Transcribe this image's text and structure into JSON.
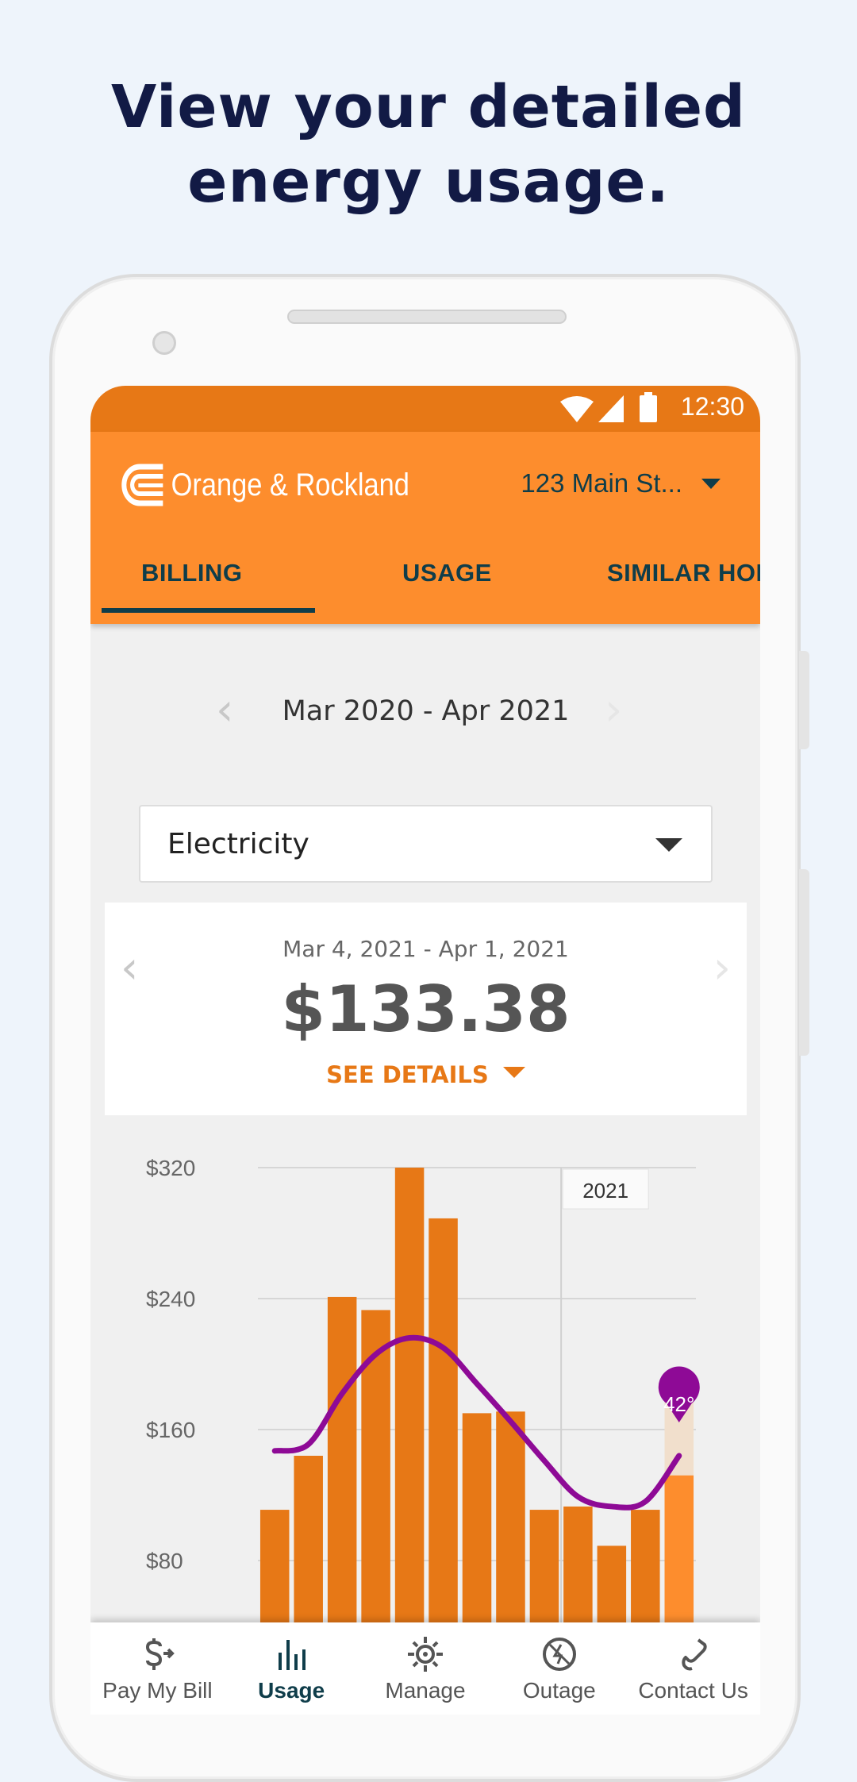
{
  "headline": {
    "line1": "View your detailed",
    "line2": "energy usage."
  },
  "status_bar": {
    "time": "12:30",
    "icons": [
      "wifi-icon",
      "signal-icon",
      "battery-icon"
    ]
  },
  "app_bar": {
    "brand": "Orange & Rockland",
    "account": "123 Main St...",
    "brand_color": "#fd8d2d"
  },
  "tabs": [
    {
      "label": "BILLING",
      "active": true
    },
    {
      "label": "USAGE",
      "active": false
    },
    {
      "label": "SIMILAR HOMES",
      "active": false
    }
  ],
  "tabs_visible": [
    "BILLING",
    "USAGE",
    "SIMILAR HOM"
  ],
  "billing": {
    "date_range": "Mar 2020 - Apr 2021",
    "service_selected": "Electricity",
    "bill_period": "Mar 4, 2021 - Apr 1, 2021",
    "amount": "$133.38",
    "see_details": "SEE DETAILS"
  },
  "chart_data": {
    "type": "bar",
    "y_ticks": [
      "$320",
      "$240",
      "$160",
      "$80"
    ],
    "ylim": [
      0,
      320
    ],
    "grid": true,
    "year_marker": "2021",
    "year_marker_before_index": 9,
    "values": [
      111,
      144,
      241,
      233,
      320,
      289,
      170,
      171,
      111,
      113,
      89,
      111,
      132
    ],
    "selected_index": 12,
    "temperature_line": [
      147,
      151,
      182,
      206,
      216,
      210,
      188,
      165,
      141,
      119,
      113,
      116,
      144
    ],
    "temperature_label": "42°",
    "bar_color": "#e77816",
    "selected_color": "#fd8d2d",
    "line_color": "#8e0a96"
  },
  "bottom_nav": [
    {
      "label": "Pay My Bill",
      "icon": "pay-bill-icon",
      "active": false
    },
    {
      "label": "Usage",
      "icon": "usage-chart-icon",
      "active": true
    },
    {
      "label": "Manage",
      "icon": "manage-icon",
      "active": false
    },
    {
      "label": "Outage",
      "icon": "outage-icon",
      "active": false
    },
    {
      "label": "Contact Us",
      "icon": "phone-icon",
      "active": false
    }
  ]
}
